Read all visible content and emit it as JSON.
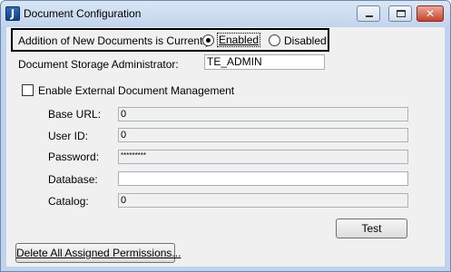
{
  "window": {
    "title": "Document Configuration",
    "app_icon_letter": "J",
    "close_glyph": "✕"
  },
  "addition": {
    "label": "Addition of New Documents is Currently:",
    "enabled_label": "Enabled",
    "disabled_label": "Disabled",
    "selected": "Enabled"
  },
  "storage_admin": {
    "label": "Document Storage Administrator:",
    "value": "TE_ADMIN"
  },
  "external_mgmt": {
    "label": "Enable External Document Management",
    "checked": false
  },
  "fields": {
    "base_url_label": "Base URL:",
    "base_url_value": "0",
    "user_id_label": "User ID:",
    "user_id_value": "0",
    "password_label": "Password:",
    "password_value": "*********",
    "database_label": "Database:",
    "database_value": "",
    "catalog_label": "Catalog:",
    "catalog_value": "0"
  },
  "buttons": {
    "test": "Test",
    "delete_permissions": "Delete All Assigned Permissions..."
  }
}
